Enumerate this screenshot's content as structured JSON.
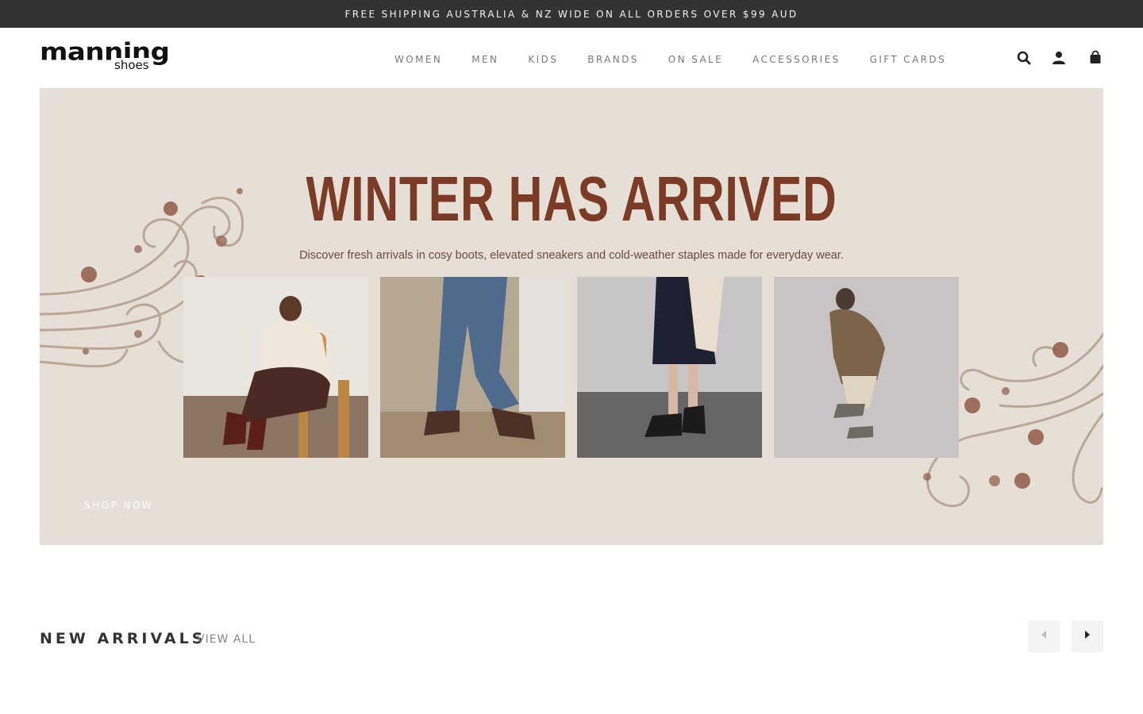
{
  "announcement": {
    "text": "FREE SHIPPING AUSTRALIA & NZ WIDE ON ALL ORDERS OVER $99 AUD"
  },
  "header": {
    "logo_main": "manning",
    "logo_sub": "shoes",
    "nav": [
      {
        "label": "WOMEN"
      },
      {
        "label": "MEN"
      },
      {
        "label": "KIDS"
      },
      {
        "label": "BRANDS"
      },
      {
        "label": "ON SALE"
      },
      {
        "label": "ACCESSORIES"
      },
      {
        "label": "GIFT CARDS"
      }
    ],
    "icons": [
      "search-icon",
      "account-icon",
      "cart-icon"
    ]
  },
  "hero": {
    "title": "WINTER HAS ARRIVED",
    "subtitle": "Discover fresh arrivals in cosy boots, elevated sneakers and cold-weather staples made for everyday wear.",
    "cta": "SHOP NOW",
    "colors": {
      "background": "#e5dfd5",
      "title": "#7b3b24",
      "swirl": "#b9a898",
      "snowflake": "#8f5a45"
    }
  },
  "new_arrivals": {
    "title": "NEW ARRIVALS",
    "view_all": "VIEW ALL",
    "prev_icon": "chevron-left-icon",
    "next_icon": "chevron-right-icon"
  },
  "colors": {
    "announcement_bg": "#333333",
    "nav_text": "#7a7a7a",
    "accent": "#222222"
  }
}
